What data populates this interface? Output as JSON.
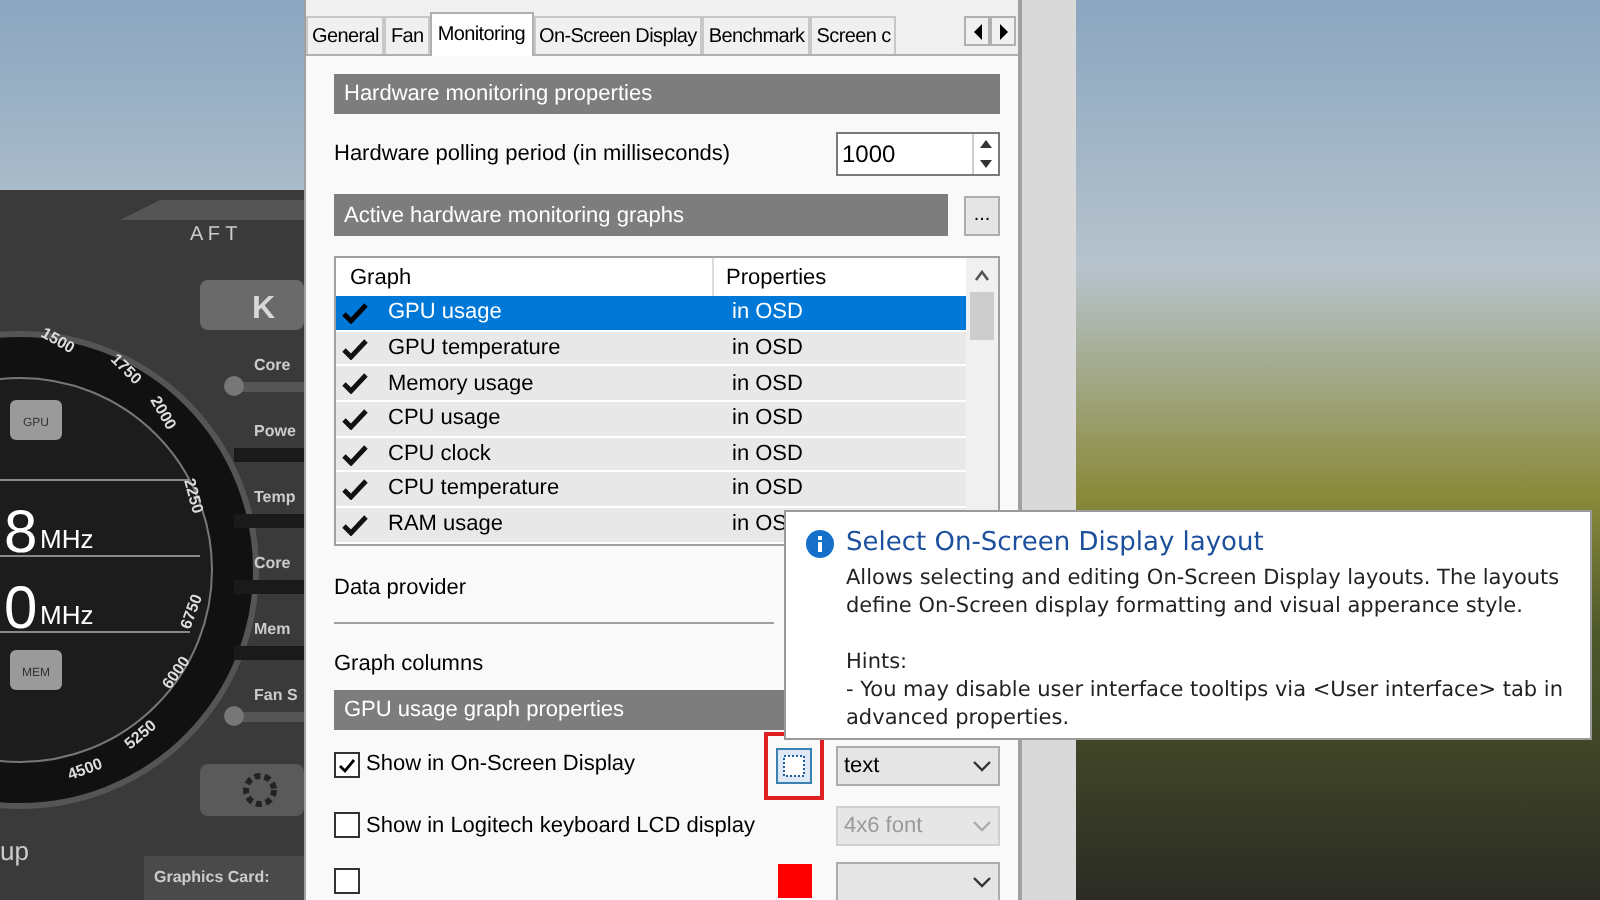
{
  "skin": {
    "logo": "A F T",
    "top_button": "K",
    "gauge_ticks": [
      "1500",
      "1750",
      "2000",
      "2250",
      "6750",
      "6000",
      "5250",
      "4500"
    ],
    "chips": [
      "GPU",
      "MEM"
    ],
    "readouts": [
      {
        "value": "8",
        "unit": "MHz"
      },
      {
        "value": "0",
        "unit": "MHz"
      }
    ],
    "controls": [
      {
        "label": "Core",
        "kind": "slider"
      },
      {
        "label": "Powe",
        "kind": "meter"
      },
      {
        "label": "Temp",
        "kind": "meter"
      },
      {
        "label": "Core",
        "kind": "meter"
      },
      {
        "label": "Mem",
        "kind": "meter"
      },
      {
        "label": "Fan S",
        "kind": "slider"
      }
    ],
    "bottom_label": "up",
    "card_label": "Graphics Card:"
  },
  "dialog": {
    "tabs": [
      {
        "label": "General",
        "selected": false
      },
      {
        "label": "Fan",
        "selected": false
      },
      {
        "label": "Monitoring",
        "selected": true
      },
      {
        "label": "On-Screen Display",
        "selected": false
      },
      {
        "label": "Benchmark",
        "selected": false
      },
      {
        "label": "Screen c",
        "selected": false
      }
    ],
    "hardware_header": "Hardware monitoring properties",
    "polling": {
      "label": "Hardware polling period (in milliseconds)",
      "value": "1000"
    },
    "graphs_header": "Active hardware monitoring graphs",
    "graphs_button": "...",
    "graph_table": {
      "columns": [
        "Graph",
        "Properties"
      ],
      "rows": [
        {
          "name": "GPU usage",
          "properties": "in OSD",
          "checked": true,
          "selected": true
        },
        {
          "name": "GPU temperature",
          "properties": "in OSD",
          "checked": true,
          "selected": false
        },
        {
          "name": "Memory usage",
          "properties": "in OSD",
          "checked": true,
          "selected": false
        },
        {
          "name": "CPU usage",
          "properties": "in OSD",
          "checked": true,
          "selected": false
        },
        {
          "name": "CPU clock",
          "properties": "in OSD",
          "checked": true,
          "selected": false
        },
        {
          "name": "CPU temperature",
          "properties": "in OSD",
          "checked": true,
          "selected": false
        },
        {
          "name": "RAM usage",
          "properties": "in OS",
          "checked": true,
          "selected": false
        }
      ]
    },
    "data_provider": "Data provider",
    "graph_columns": "Graph columns",
    "graph_header": "GPU usage graph properties",
    "options": [
      {
        "kind": "layout",
        "label": "Show in On-Screen Display",
        "checked": true,
        "highlighted": true,
        "selector": "text",
        "disabled": false
      },
      {
        "kind": "plain",
        "label": "Show in Logitech keyboard LCD display",
        "checked": false,
        "selector": "4x6 font",
        "disabled": true
      },
      {
        "kind": "swatch",
        "checked": false,
        "color": "#ff0000"
      }
    ]
  },
  "tooltip": {
    "title": "Select On-Screen Display layout",
    "body": "Allows selecting and editing On-Screen Display layouts. The layouts define On-Screen display formatting and visual apperance style.",
    "hints_title": "Hints:",
    "hint": "- You may disable user interface tooltips via <User interface> tab in advanced properties."
  }
}
